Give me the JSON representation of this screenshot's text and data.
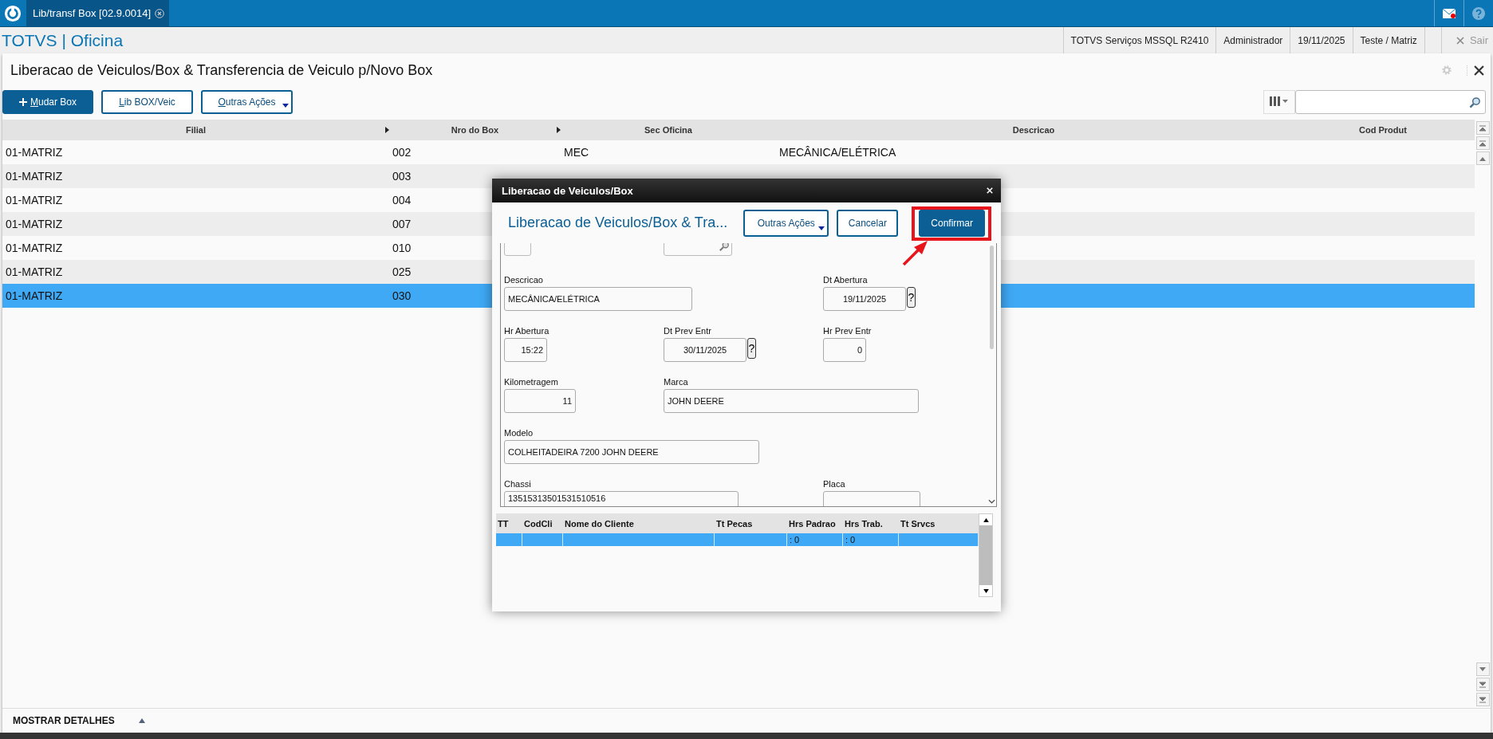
{
  "app_tab": {
    "title": "Lib/transf Box [02.9.0014]"
  },
  "header": {
    "brand": "TOTVS | Oficina",
    "info": [
      "TOTVS Serviços MSSQL R2410",
      "Administrador",
      "19/11/2025",
      "Teste / Matriz"
    ],
    "exit": "Sair"
  },
  "page": {
    "title": "Liberacao de Veiculos/Box & Transferencia de Veiculo p/Novo Box",
    "actions": [
      {
        "label": "Mudar Box",
        "kind": "primary"
      },
      {
        "label": "Lib BOX/Veic",
        "kind": "secondary"
      },
      {
        "label": "Outras Ações",
        "kind": "menu"
      }
    ]
  },
  "grid": {
    "columns": [
      {
        "label": "Filial",
        "sort_arrow": true
      },
      {
        "label": "Nro do Box",
        "sort_arrow": true
      },
      {
        "label": "Sec Oficina",
        "sort_arrow": false
      },
      {
        "label": "Descricao",
        "sort_arrow": false
      },
      {
        "label": "Cod Produt",
        "sort_arrow": false
      }
    ],
    "rows": [
      {
        "cells": [
          "01-MATRIZ",
          "002",
          "MEC",
          "MECÂNICA/ELÉTRICA"
        ],
        "selected": false
      },
      {
        "cells": [
          "01-MATRIZ",
          "003"
        ],
        "selected": false
      },
      {
        "cells": [
          "01-MATRIZ",
          "004"
        ],
        "selected": false
      },
      {
        "cells": [
          "01-MATRIZ",
          "007"
        ],
        "selected": false
      },
      {
        "cells": [
          "01-MATRIZ",
          "010"
        ],
        "selected": false
      },
      {
        "cells": [
          "01-MATRIZ",
          "025"
        ],
        "selected": false
      },
      {
        "cells": [
          "01-MATRIZ",
          "030"
        ],
        "selected": true
      }
    ]
  },
  "dialog": {
    "title": "Liberacao de Veiculos/Box",
    "heading": "Liberacao de Veiculos/Box & Tra...",
    "buttons": [
      {
        "label": "Outras Ações",
        "kind": "menu"
      },
      {
        "label": "Cancelar",
        "kind": "secondary"
      },
      {
        "label": "Confirmar",
        "kind": "primary"
      }
    ],
    "fields": [
      {
        "label": "Descricao",
        "value": "MECÂNICA/ELÉTRICA",
        "kind": "text"
      },
      {
        "label": "Dt Abertura",
        "value": "19/11/2025",
        "kind": "date",
        "help": "?"
      },
      {
        "label": "Hr Abertura",
        "value": "15:22",
        "kind": "number"
      },
      {
        "label": "Dt Prev Entr",
        "value": "30/11/2025",
        "kind": "date",
        "help": "?"
      },
      {
        "label": "Hr Prev Entr",
        "value": "0",
        "kind": "number"
      },
      {
        "label": "Kilometragem",
        "value": "11",
        "kind": "number"
      },
      {
        "label": "Marca",
        "value": "JOHN DEERE",
        "kind": "text"
      },
      {
        "label": "Modelo",
        "value": "COLHEITADEIRA 7200  JOHN DEERE",
        "kind": "text"
      },
      {
        "label": "Chassi",
        "value": "13515313501531510516",
        "kind": "text"
      },
      {
        "label": "Placa",
        "kind": "text"
      }
    ],
    "table": {
      "columns": [
        "TT",
        "CodCli",
        "Nome do Cliente",
        "Tt Pecas",
        "Hrs Padrao",
        "Hrs Trab.",
        "Tt Srvcs"
      ],
      "rows": [
        {
          "selected": true,
          "hrs_padrao": ": 0",
          "hrs_trab": ": 0"
        }
      ]
    }
  },
  "annotation": {
    "highlight": true,
    "arrow": true
  },
  "footer": {
    "label": "MOSTRAR DETALHES"
  }
}
